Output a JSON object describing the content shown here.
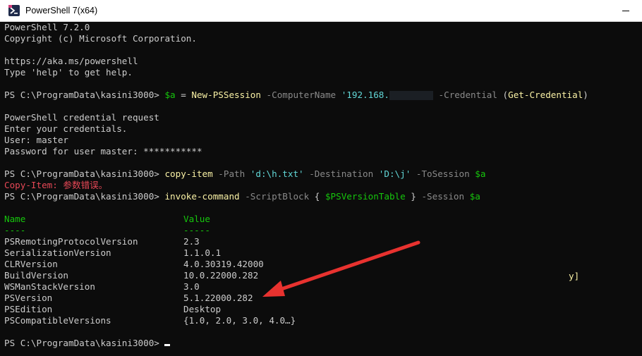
{
  "window": {
    "title": "PowerShell 7(x64)"
  },
  "colors": {
    "background": "#0c0c0c",
    "command": "#f9f1a5",
    "parameter": "#8a8a8a",
    "string": "#61d6d6",
    "variable": "#16c60c",
    "error": "#e74856",
    "table_header": "#16c60c",
    "annotation_arrow": "#e8322f"
  },
  "terminal": {
    "banner": {
      "version": "PowerShell 7.2.0",
      "copyright": "Copyright (c) Microsoft Corporation.",
      "url": "https://aka.ms/powershell",
      "help": "Type 'help' to get help."
    },
    "prompt": "PS C:\\ProgramData\\kasini3000> ",
    "cmd1": {
      "var": "$a",
      "eq": " = ",
      "command": "New-PSSession",
      "param1": " -ComputerName ",
      "arg1": "'192.168.",
      "param2": " -Credential ",
      "paren_open": "(",
      "inner": "Get-Credential",
      "paren_close": ")"
    },
    "cred": {
      "title": "PowerShell credential request",
      "enter": "Enter your credentials.",
      "user": "User: master",
      "password": "Password for user master: ***********"
    },
    "cmd2": {
      "command": "copy-item",
      "param1": " -Path ",
      "arg1": "'d:\\h.txt'",
      "param2": " -Destination ",
      "arg2": "'D:\\j'",
      "param3": " -ToSession ",
      "var": "$a"
    },
    "error": "Copy-Item: 参数错误。",
    "cmd3": {
      "command": "invoke-command",
      "param1": " -ScriptBlock ",
      "brace_open": "{ ",
      "var": "$PSVersionTable",
      "brace_close": " }",
      "param2": " -Session ",
      "var2": "$a"
    },
    "table": {
      "headers": [
        "Name",
        "Value"
      ],
      "underline": [
        "----",
        "-----"
      ],
      "rows": [
        [
          "PSRemotingProtocolVersion",
          "2.3"
        ],
        [
          "SerializationVersion",
          "1.1.0.1"
        ],
        [
          "CLRVersion",
          "4.0.30319.42000"
        ],
        [
          "BuildVersion",
          "10.0.22000.282"
        ],
        [
          "WSManStackVersion",
          "3.0"
        ],
        [
          "PSVersion",
          "5.1.22000.282"
        ],
        [
          "PSEdition",
          "Desktop"
        ],
        [
          "PSCompatibleVersions",
          "{1.0, 2.0, 3.0, 4.0…}"
        ]
      ]
    },
    "stray_text": "y]"
  }
}
